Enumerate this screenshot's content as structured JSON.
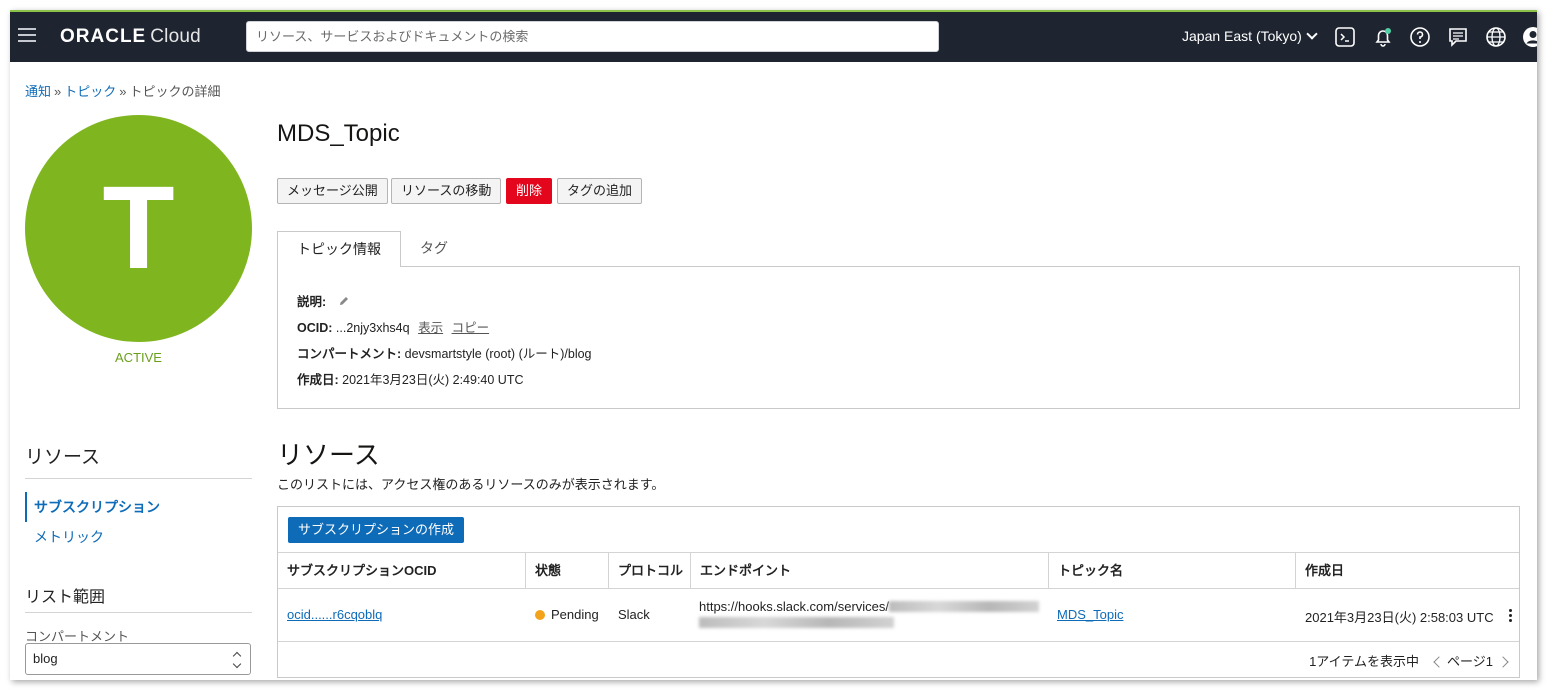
{
  "header": {
    "logo_oracle": "ORACLE",
    "logo_cloud": "Cloud",
    "search_placeholder": "リソース、サービスおよびドキュメントの検索",
    "region": "Japan East (Tokyo)"
  },
  "breadcrumb": {
    "items": [
      "通知",
      "トピック",
      "トピックの詳細"
    ],
    "separator": "»"
  },
  "avatar": {
    "letter": "T",
    "color": "#7fb620"
  },
  "status": "ACTIVE",
  "title": "MDS_Topic",
  "actions": {
    "publish": "メッセージ公開",
    "move": "リソースの移動",
    "delete": "削除",
    "add_tag": "タグの追加"
  },
  "tabs": {
    "info": "トピック情報",
    "tags": "タグ"
  },
  "info": {
    "description_label": "説明:",
    "ocid_label": "OCID:",
    "ocid_value": "...2njy3xhs4q",
    "show_link": "表示",
    "copy_link": "コピー",
    "compartment_label": "コンパートメント:",
    "compartment_value": "devsmartstyle (root) (ルート)/blog",
    "created_label": "作成日:",
    "created_value": "2021年3月23日(火) 2:49:40 UTC"
  },
  "sidebar": {
    "resources_heading": "リソース",
    "items": [
      "サブスクリプション",
      "メトリック"
    ],
    "scope_heading": "リスト範囲",
    "compartment_label": "コンパートメント",
    "compartment_value": "blog"
  },
  "resources": {
    "title": "リソース",
    "description": "このリストには、アクセス権のあるリソースのみが表示されます。",
    "create_button": "サブスクリプションの作成",
    "columns": [
      "サブスクリプションOCID",
      "状態",
      "プロトコル",
      "エンドポイント",
      "トピック名",
      "作成日"
    ],
    "rows": [
      {
        "ocid": "ocid......r6cqoblq",
        "state": "Pending",
        "protocol": "Slack",
        "endpoint": "https://hooks.slack.com/services/",
        "topic": "MDS_Topic",
        "created": "2021年3月23日(火) 2:58:03 UTC"
      }
    ],
    "footer_count": "1アイテムを表示中",
    "page": "ページ1"
  },
  "colors": {
    "header_bg": "#1e2530",
    "link": "#0d6bb8",
    "active_green": "#7fb620",
    "danger": "#e4061d",
    "pending": "#f2a31a"
  }
}
